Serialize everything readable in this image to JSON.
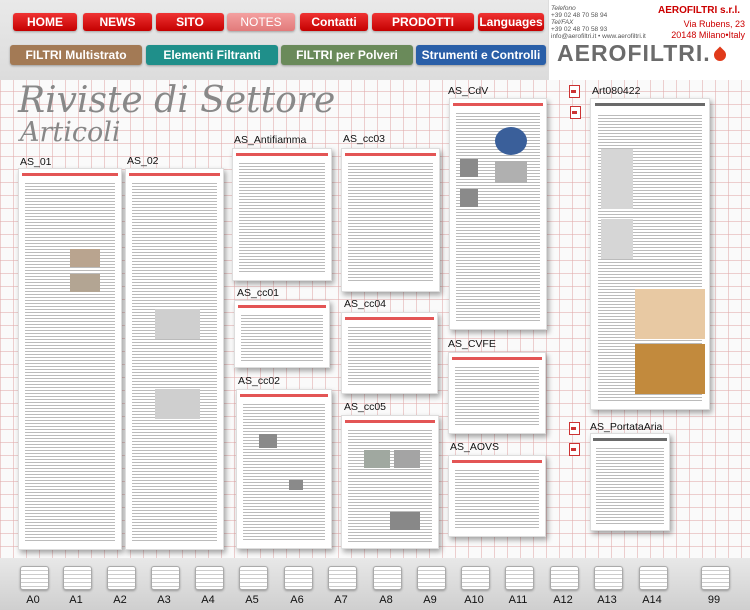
{
  "nav": {
    "home": "HOME",
    "news": "NEWS",
    "sito": "SITO",
    "notes": "NOTES",
    "contatti": "Contatti",
    "prodotti": "PRODOTTI",
    "languages": "Languages"
  },
  "categories": [
    {
      "label": "FILTRI Multistrato",
      "color": "#a37a55"
    },
    {
      "label": "Elementi Filtranti",
      "color": "#1f8f8a"
    },
    {
      "label": "FILTRI per Polveri",
      "color": "#6a8a5a"
    },
    {
      "label": "Strumenti e Controlli",
      "color": "#2a5fa8"
    }
  ],
  "contact": {
    "tel_label": "Telefono",
    "tel": "+39 02 48 70 58 94",
    "fax_label": "Tel/FAX",
    "fax": "+39 02 48 70 58 93",
    "web": "info@aerofiltri.it • www.aerofiltri.it",
    "company": "AEROFILTRI s.r.l.",
    "street": "Via Rubens, 23",
    "city": "20148 Milano•Italy",
    "logo": "AEROFILTRI."
  },
  "heading": {
    "title": "Riviste di Settore",
    "subtitle": "Articoli"
  },
  "docs": {
    "as01": "AS_01",
    "as02": "AS_02",
    "antifiamma": "AS_Antifiamma",
    "cc01": "AS_cc01",
    "cc02": "AS_cc02",
    "cc03": "AS_cc03",
    "cc04": "AS_cc04",
    "cc05": "AS_cc05",
    "cdv": "AS_CdV",
    "cvfe": "AS_CVFE",
    "aovs": "AS_AOVS",
    "art": "Art080422",
    "portata": "AS_PortataAria"
  },
  "thumbs": [
    "A0",
    "A1",
    "A2",
    "A3",
    "A4",
    "A5",
    "A6",
    "A7",
    "A8",
    "A9",
    "A10",
    "A11",
    "A12",
    "A13",
    "A14",
    "99"
  ],
  "colors": {
    "nav_red": "#d40000",
    "brand_red": "#cc0000"
  }
}
